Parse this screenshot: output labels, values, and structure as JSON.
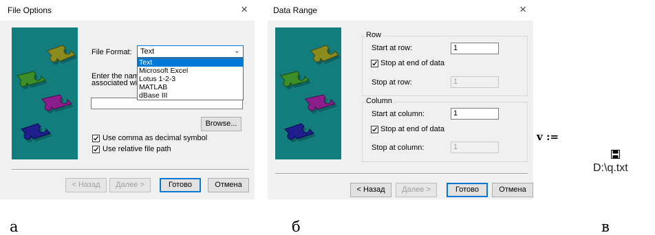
{
  "dialog_a": {
    "title": "File Options",
    "close_glyph": "×",
    "file_format_label": "File Format:",
    "file_format_value": "Text",
    "file_format_options": [
      "Text",
      "Microsoft Excel",
      "Lotus 1-2-3",
      "MATLAB",
      "dBase III"
    ],
    "enter_name_line1": "Enter the name o",
    "enter_name_line2": "associated with t",
    "path_value": "",
    "browse_label": "Browse...",
    "use_comma_label": "Use comma as decimal symbol",
    "use_comma_checked": true,
    "relative_path_label": "Use relative file path",
    "relative_path_checked": true,
    "back_label": "< Назад",
    "next_label": "Далее >",
    "finish_label": "Готово",
    "cancel_label": "Отмена"
  },
  "dialog_b": {
    "title": "Data Range",
    "close_glyph": "×",
    "row_group_title": "Row",
    "start_at_row_label": "Start at row:",
    "start_at_row_value": "1",
    "stop_at_end_row_label": "Stop at end of data",
    "stop_at_end_row_checked": true,
    "stop_at_row_label": "Stop at row:",
    "stop_at_row_value": "1",
    "column_group_title": "Column",
    "start_at_column_label": "Start at column:",
    "start_at_column_value": "1",
    "stop_at_end_column_label": "Stop at end of data",
    "stop_at_end_column_checked": true,
    "stop_at_column_label": "Stop at column:",
    "stop_at_column_value": "1",
    "back_label": "< Назад",
    "next_label": "Далее >",
    "finish_label": "Готово",
    "cancel_label": "Отмена"
  },
  "worksheet": {
    "variable": "v :=",
    "file_icon": "save-disk-icon",
    "file_path": "D:\\q.txt"
  },
  "captions": {
    "a": "а",
    "b": "б",
    "c": "в"
  },
  "colors": {
    "picture_background": "#137d7d",
    "puzzle_olive": "#8c8c1e",
    "puzzle_green": "#3c8c28",
    "puzzle_purple": "#8c1e8c",
    "puzzle_blue": "#1e1e8c",
    "accent": "#0078d7"
  }
}
